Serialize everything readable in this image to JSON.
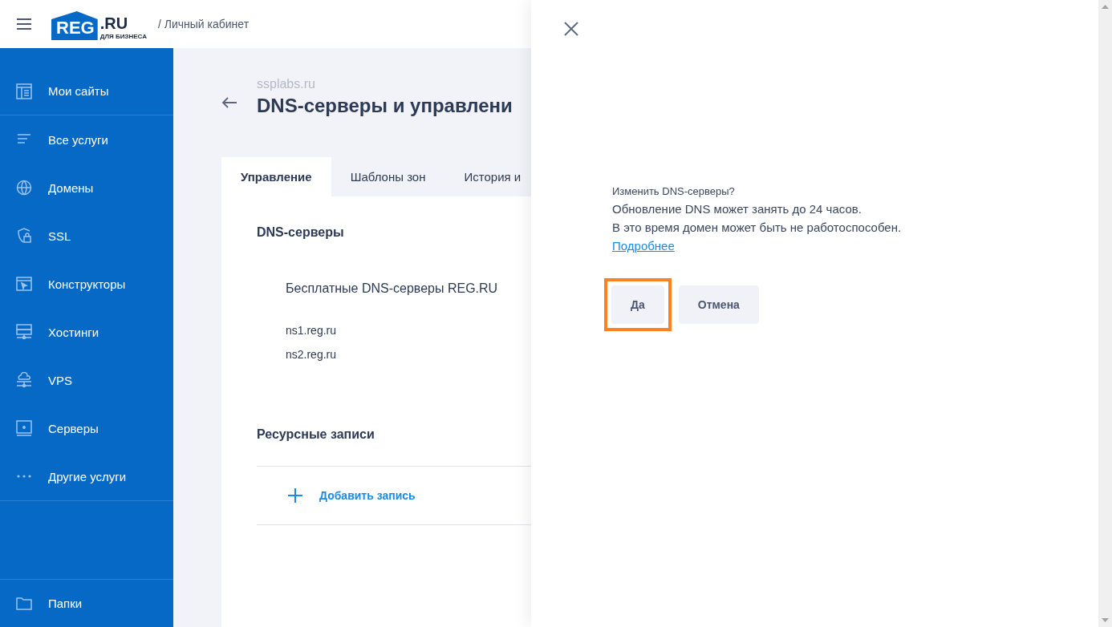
{
  "header": {
    "logo": {
      "main": "REG",
      "suffix": ".RU",
      "tagline": "ДЛЯ БИЗНЕСА"
    },
    "breadcrumb": "/ Личный кабинет"
  },
  "sidebar": {
    "items": [
      {
        "label": "Мои сайты",
        "selected": false
      },
      {
        "label": "Все услуги",
        "selected": false
      },
      {
        "label": "Домены",
        "selected": false
      },
      {
        "label": "SSL",
        "selected": false
      },
      {
        "label": "Конструкторы",
        "selected": false
      },
      {
        "label": "Хостинги",
        "selected": false
      },
      {
        "label": "VPS",
        "selected": false
      },
      {
        "label": "Серверы",
        "selected": false
      },
      {
        "label": "Другие услуги",
        "selected": false
      }
    ],
    "footer": {
      "label": "Папки"
    }
  },
  "page": {
    "domain": "ssplabs.ru",
    "title": "DNS-серверы и управлени",
    "tabs": [
      {
        "label": "Управление",
        "selected": true
      },
      {
        "label": "Шаблоны зон",
        "selected": false
      },
      {
        "label": "История и",
        "selected": false
      }
    ],
    "dns_section": {
      "heading": "DNS-серверы",
      "provider": "Бесплатные DNS-серверы REG.RU",
      "servers": [
        "ns1.reg.ru",
        "ns2.reg.ru"
      ]
    },
    "records_section": {
      "heading": "Ресурсные записи",
      "add_link": "Добавить запись"
    }
  },
  "dialog": {
    "question": "Изменить DNS-серверы?",
    "lines": [
      "Обновление DNS может занять до 24 часов.",
      "В это время домен может быть не работоспособен."
    ],
    "link": "Подробнее",
    "buttons": [
      {
        "label": "Да",
        "highlighted": true
      },
      {
        "label": "Отмена",
        "highlighted": false
      }
    ]
  }
}
